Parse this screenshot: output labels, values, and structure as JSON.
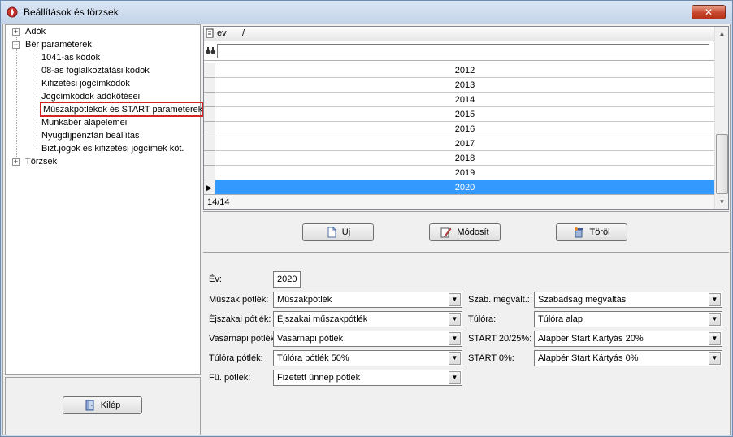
{
  "window": {
    "title": "Beállítások és törzsek",
    "close_label": "✕"
  },
  "tree": {
    "items": [
      {
        "label": "Adók",
        "expander": "+"
      },
      {
        "label": "Bér paraméterek",
        "expander": "−"
      },
      {
        "label": "1041-as kódok"
      },
      {
        "label": "08-as foglalkoztatási kódok"
      },
      {
        "label": "Kifizetési jogcímkódok"
      },
      {
        "label": "Jogcímkódok adókötései"
      },
      {
        "label": "Műszakpótlékok és START paraméterek"
      },
      {
        "label": "Munkabér alapelemei"
      },
      {
        "label": "Nyugdíjpénztári beállítás"
      },
      {
        "label": "Bizt.jogok és kifizetési jogcímek köt."
      },
      {
        "label": "Törzsek",
        "expander": "+"
      }
    ]
  },
  "exit_button": {
    "label": "Kilép"
  },
  "grid": {
    "column_header": "ev",
    "sort_glyph": "/",
    "rows": [
      "2012",
      "2013",
      "2014",
      "2015",
      "2016",
      "2017",
      "2018",
      "2019",
      "2020"
    ],
    "selected_row": "2020",
    "status": "14/14"
  },
  "actions": {
    "new_label": "Új",
    "modify_label": "Módosít",
    "delete_label": "Töröl"
  },
  "form": {
    "year_label": "Év:",
    "year_value": "2020",
    "left": [
      {
        "label": "Műszak pótlék:",
        "value": "Műszakpótlék"
      },
      {
        "label": "Éjszakai pótlék:",
        "value": "Éjszakai műszakpótlék"
      },
      {
        "label": "Vasárnapi pótlék",
        "value": "Vasárnapi pótlék"
      },
      {
        "label": "Túlóra pótlék:",
        "value": "Túlóra pótlék 50%"
      },
      {
        "label": "Fü. pótlék:",
        "value": "Fizetett ünnep pótlék"
      }
    ],
    "right": [
      {
        "label": "Szab. megvált.:",
        "value": "Szabadság megváltás"
      },
      {
        "label": "Túlóra:",
        "value": "Túlóra alap"
      },
      {
        "label": "START 20/25%:",
        "value": "Alapbér Start Kártyás 20%"
      },
      {
        "label": "START 0%:",
        "value": "Alapbér Start Kártyás 0%"
      }
    ]
  },
  "colors": {
    "selection": "#3399ff",
    "highlight_border": "#d62424",
    "close_button": "#c7452c"
  }
}
